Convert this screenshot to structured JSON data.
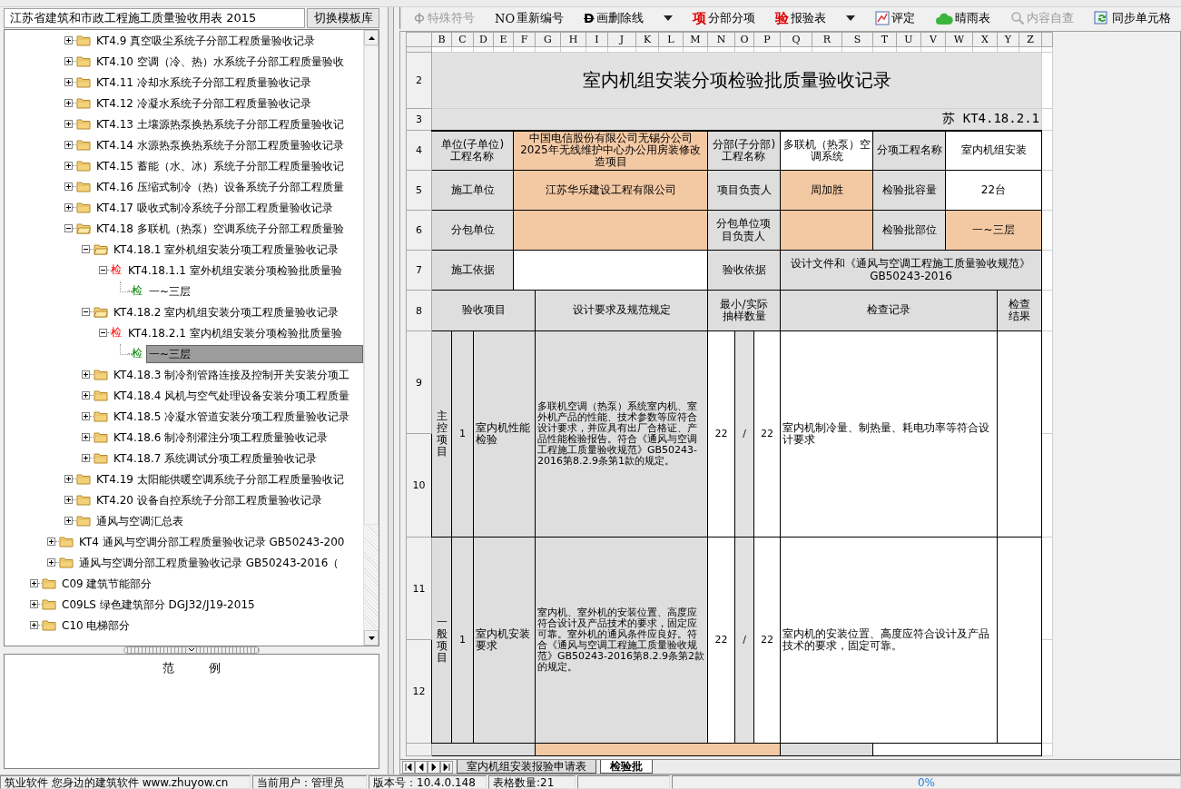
{
  "template": {
    "value": "江苏省建筑和市政工程施工质量验收用表 2015",
    "button": "切换模板库"
  },
  "tree": {
    "items": [
      {
        "children": [
          {
            "children": [
              {
                "kind": "folder",
                "label": "KT4.9 真空吸尘系统子分部工程质量验收记录",
                "expanded": false,
                "selected": false
              },
              {
                "kind": "folder",
                "label": "KT4.10 空调（冷、热）水系统子分部工程质量验收",
                "expanded": false,
                "selected": false
              },
              {
                "kind": "folder",
                "label": "KT4.11 冷却水系统子分部工程质量验收记录",
                "expanded": false,
                "selected": false
              },
              {
                "kind": "folder",
                "label": "KT4.12 冷凝水系统子分部工程质量验收记录",
                "expanded": false,
                "selected": false
              },
              {
                "kind": "folder",
                "label": "KT4.13 土壤源热泵换热系统子分部工程质量验收记",
                "expanded": false,
                "selected": false
              },
              {
                "kind": "folder",
                "label": "KT4.14 水源热泵换热系统子分部工程质量验收记录",
                "expanded": false,
                "selected": false
              },
              {
                "kind": "folder",
                "label": "KT4.15 蓄能（水、冰）系统子分部工程质量验收记",
                "expanded": false,
                "selected": false
              },
              {
                "kind": "folder",
                "label": "KT4.16 压缩式制冷（热）设备系统子分部工程质量",
                "expanded": false,
                "selected": false
              },
              {
                "kind": "folder",
                "label": "KT4.17 吸收式制冷系统子分部工程质量验收记录",
                "expanded": false,
                "selected": false
              },
              {
                "kind": "folder",
                "label": "KT4.18 多联机（热泵）空调系统子分部工程质量验",
                "expanded": true,
                "selected": false,
                "children": [
                  {
                    "kind": "folder",
                    "label": "KT4.18.1 室外机组安装分项工程质量验收记录",
                    "expanded": true,
                    "selected": false,
                    "children": [
                      {
                        "kind": "check",
                        "glyph": "检",
                        "color": "#ff0000",
                        "label": "KT4.18.1.1 室外机组安装分项检验批质量验",
                        "expanded": true,
                        "selected": false,
                        "children": [
                          {
                            "kind": "check",
                            "glyph": "检",
                            "color": "#008000",
                            "label": "一~三层",
                            "selected": false
                          }
                        ]
                      }
                    ]
                  },
                  {
                    "kind": "folder",
                    "label": "KT4.18.2 室内机组安装分项工程质量验收记录",
                    "expanded": true,
                    "selected": false,
                    "children": [
                      {
                        "kind": "check",
                        "glyph": "检",
                        "color": "#ff0000",
                        "label": "KT4.18.2.1 室内机组安装分项检验批质量验",
                        "expanded": true,
                        "selected": false,
                        "children": [
                          {
                            "kind": "check",
                            "glyph": "检",
                            "color": "#008000",
                            "label": "一~三层",
                            "selected": true
                          }
                        ]
                      }
                    ]
                  },
                  {
                    "kind": "folder",
                    "label": "KT4.18.3 制冷剂管路连接及控制开关安装分项工",
                    "expanded": false,
                    "selected": false
                  },
                  {
                    "kind": "folder",
                    "label": "KT4.18.4 风机与空气处理设备安装分项工程质量",
                    "expanded": false,
                    "selected": false
                  },
                  {
                    "kind": "folder",
                    "label": "KT4.18.5 冷凝水管道安装分项工程质量验收记录",
                    "expanded": false,
                    "selected": false
                  },
                  {
                    "kind": "folder",
                    "label": "KT4.18.6 制冷剂灌注分项工程质量验收记录",
                    "expanded": false,
                    "selected": false
                  },
                  {
                    "kind": "folder",
                    "label": "KT4.18.7 系统调试分项工程质量验收记录",
                    "expanded": false,
                    "selected": false
                  }
                ]
              },
              {
                "kind": "folder",
                "label": "KT4.19 太阳能供暖空调系统子分部工程质量验收记",
                "expanded": false,
                "selected": false
              },
              {
                "kind": "folder",
                "label": "KT4.20 设备自控系统子分部工程质量验收记录",
                "expanded": false,
                "selected": false
              },
              {
                "kind": "folder",
                "label": "通风与空调汇总表",
                "expanded": false,
                "selected": false
              }
            ]
          },
          {
            "kind": "folder",
            "label": "KT4 通风与空调分部工程质量验收记录 GB50243-200",
            "expanded": false,
            "selected": false
          },
          {
            "kind": "folder",
            "label": "通风与空调分部工程质量验收记录 GB50243-2016（",
            "expanded": false,
            "selected": false
          }
        ]
      },
      {
        "kind": "folder",
        "label": "C09 建筑节能部分",
        "expanded": false,
        "selected": false
      },
      {
        "kind": "folder",
        "label": "C09LS 绿色建筑部分 DGJ32/J19-2015",
        "expanded": false,
        "selected": false
      },
      {
        "kind": "folder",
        "label": "C10 电梯部分",
        "expanded": false,
        "selected": false
      }
    ]
  },
  "legend": {
    "title": "范 例"
  },
  "toolbar": [
    {
      "kind": "special",
      "label": "特殊符号",
      "disabled": true
    },
    {
      "kind": "number",
      "glyph": "NO",
      "label": "重新编号",
      "disabled": false
    },
    {
      "kind": "strike",
      "glyph": "D",
      "label": "画删除线",
      "disabled": false
    },
    {
      "kind": "dropdown"
    },
    {
      "kind": "item",
      "glyph": "项",
      "label": "分部分项",
      "disabled": false
    },
    {
      "kind": "report",
      "glyph": "验",
      "label": "报验表",
      "disabled": false
    },
    {
      "kind": "dropdown"
    },
    {
      "kind": "grade",
      "label": "评定",
      "disabled": false
    },
    {
      "kind": "weather",
      "label": "晴雨表",
      "disabled": false
    },
    {
      "kind": "check",
      "label": "内容自查",
      "disabled": true
    },
    {
      "kind": "sync",
      "label": "同步单元格",
      "disabled": false
    }
  ],
  "sheet": {
    "columns": [
      "B",
      "C",
      "D",
      "E",
      "F",
      "G",
      "H",
      "I",
      "J",
      "K",
      "L",
      "M",
      "N",
      "O",
      "P",
      "Q",
      "R",
      "S",
      "T",
      "U",
      "V",
      "W",
      "X",
      "Y",
      "Z"
    ],
    "row_numbers": [
      "2",
      "3",
      "4",
      "5",
      "6",
      "7",
      "8",
      "9",
      "10",
      "11",
      "12"
    ],
    "title": "室内机组安装分项检验批质量验收记录",
    "code": "苏 KT4.18.2.1",
    "info_rows": [
      [
        {
          "kind": "label",
          "text": "单位(子单位)工程名称"
        },
        {
          "kind": "entry",
          "text": "中国电信股份有限公司无锡分公司2025年无线维护中心办公用房装修改造项目"
        },
        {
          "kind": "label",
          "text": "分部(子分部)工程名称"
        },
        {
          "kind": "plain",
          "text": "多联机（热泵）空调系统"
        },
        {
          "kind": "label",
          "text": "分项工程名称"
        },
        {
          "kind": "plain",
          "text": "室内机组安装"
        }
      ],
      [
        {
          "kind": "label",
          "text": "施工单位"
        },
        {
          "kind": "entry",
          "text": "江苏华乐建设工程有限公司"
        },
        {
          "kind": "label",
          "text": "项目负责人"
        },
        {
          "kind": "entry",
          "text": "周加胜"
        },
        {
          "kind": "label",
          "text": "检验批容量"
        },
        {
          "kind": "plain",
          "text": "22台"
        }
      ],
      [
        {
          "kind": "label",
          "text": "分包单位"
        },
        {
          "kind": "entry"
        },
        {
          "kind": "label",
          "text": "分包单位项目负责人"
        },
        {
          "kind": "entry"
        },
        {
          "kind": "label",
          "text": "检验批部位"
        },
        {
          "kind": "entry",
          "text": "一~三层"
        }
      ],
      [
        {
          "kind": "label",
          "text": "施工依据"
        },
        {
          "kind": "plain"
        },
        {
          "kind": "label",
          "text": "验收依据"
        },
        {
          "kind": "label",
          "text": "设计文件和《通风与空调工程施工质量验收规范》GB50243-2016"
        }
      ]
    ],
    "header": [
      "验收项目",
      "设计要求及规范规定",
      "最小/实际抽样数量",
      "检查记录",
      "检查结果"
    ],
    "items": [
      {
        "category": "主控项目",
        "no": "1",
        "name": "室内机性能检验",
        "requirement": "多联机空调（热泵）系统室内机、室外机产品的性能、技术参数等应符合设计要求，并应具有出厂合格证、产品性能检验报告。符合《通风与空调工程施工质量验收规范》GB50243-2016第8.2.9条第1款的规定。",
        "sample_min": "22",
        "separator": "/",
        "sample_actual": "22",
        "record": "室内机制冷量、制热量、耗电功率等符合设计要求"
      },
      {
        "category": "一般项目",
        "no": "1",
        "name": "室内机安装要求",
        "requirement": "室内机、室外机的安装位置、高度应符合设计及产品技术的要求，固定应可靠。室外机的通风条件应良好。符合《通风与空调工程施工质量验收规范》GB50243-2016第8.2.9条第2款的规定。",
        "sample_min": "22",
        "separator": "/",
        "sample_actual": "22",
        "record": "室内机的安装位置、高度应符合设计及产品技术的要求，固定可靠。"
      }
    ]
  },
  "sheet_tabs": [
    {
      "label": "室内机组安装报验申请表",
      "selected": false
    },
    {
      "label": "检验批",
      "selected": true
    }
  ],
  "status_bar": {
    "segments": [
      "筑业软件 您身边的建筑软件 www.zhuyow.cn",
      "当前用户：管理员",
      "版本号：10.4.0.148",
      "表格数量:21"
    ],
    "progress": "0%"
  }
}
